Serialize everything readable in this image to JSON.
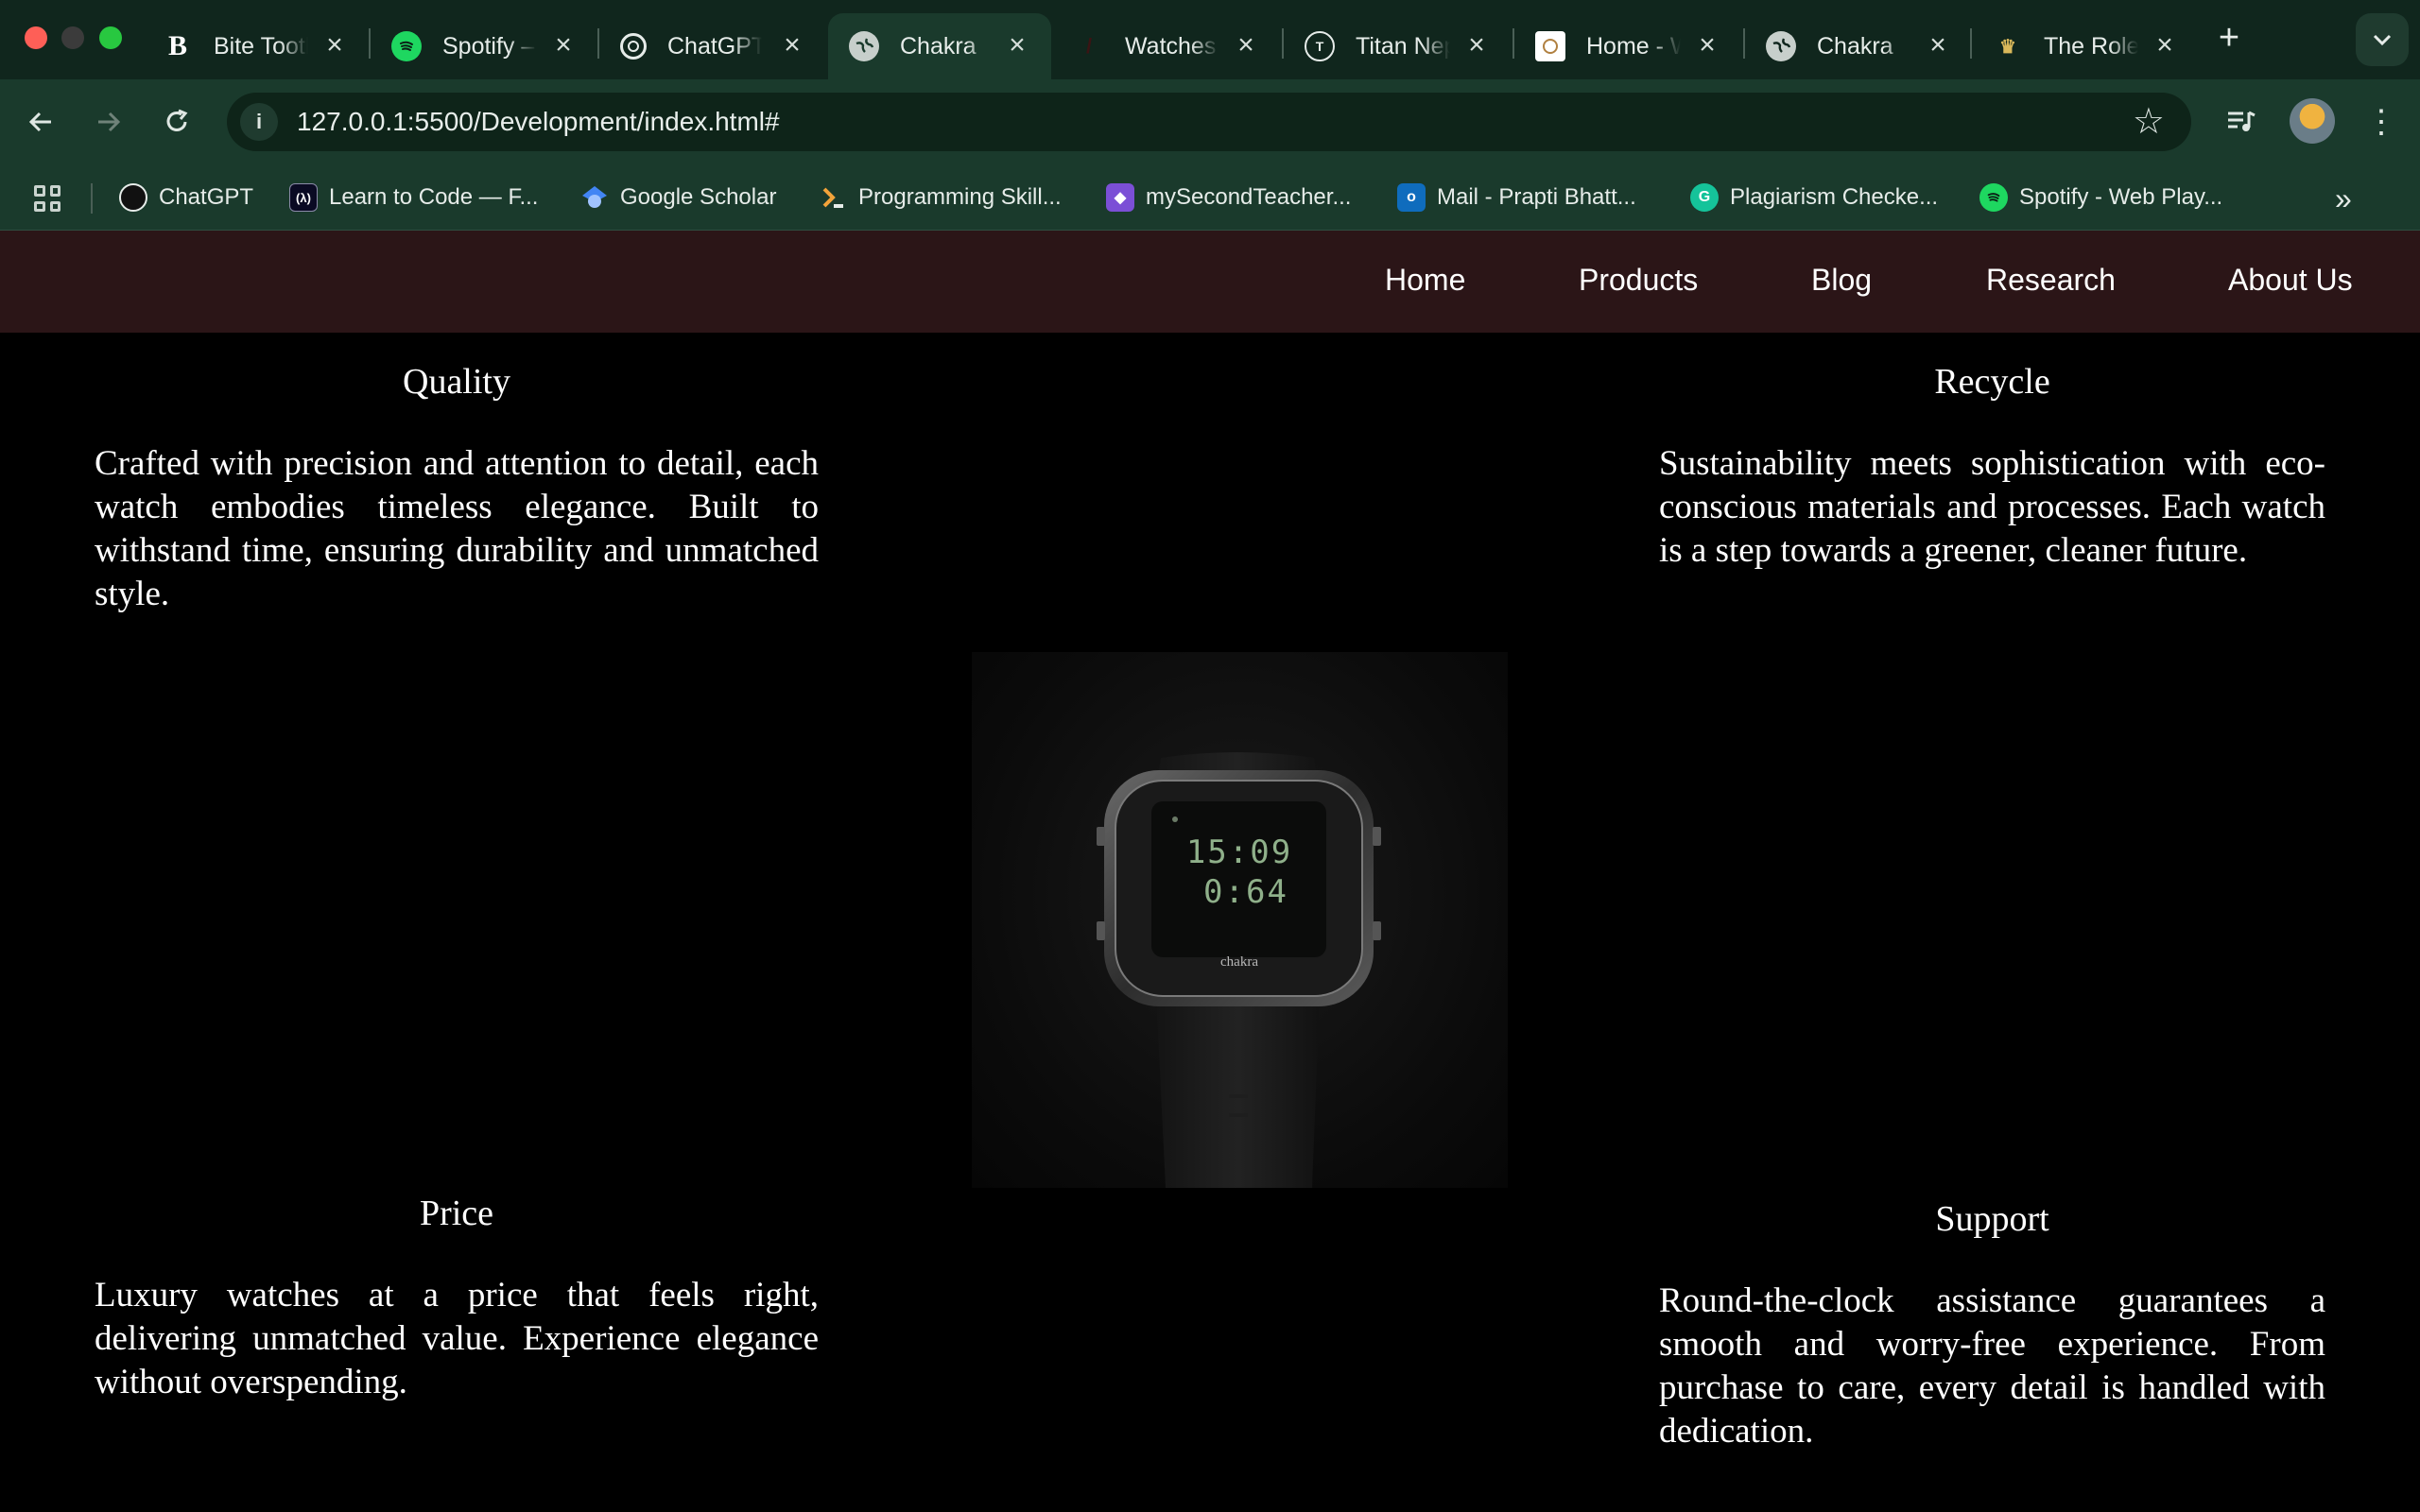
{
  "browser": {
    "tabs": [
      {
        "title": "Bite Tooth",
        "icon": "bold-b-icon"
      },
      {
        "title": "Spotify – Web",
        "icon": "spotify-icon"
      },
      {
        "title": "ChatGPT",
        "icon": "chatgpt-icon"
      },
      {
        "title": "Chakra",
        "icon": "globe-icon",
        "active": true
      },
      {
        "title": "Watches",
        "icon": "watches-icon"
      },
      {
        "title": "Titan Nepal",
        "icon": "titan-icon"
      },
      {
        "title": "Home - W",
        "icon": "home-site-icon"
      },
      {
        "title": "Chakra",
        "icon": "globe-icon"
      },
      {
        "title": "The Rolex",
        "icon": "rolex-crown-icon"
      }
    ],
    "url": "127.0.0.1:5500/Development/index.html#",
    "bookmarks": [
      {
        "label": "ChatGPT",
        "icon": "chatgpt-icon",
        "color": "#111111"
      },
      {
        "label": "Learn to Code — F...",
        "icon": "freecodecamp-icon",
        "color": "#0a0a23"
      },
      {
        "label": "Google Scholar",
        "icon": "scholar-icon",
        "color": "#4285f4"
      },
      {
        "label": "Programming Skill...",
        "icon": "programming-icon",
        "color": "#f2a33a"
      },
      {
        "label": "mySecondTeacher...",
        "icon": "mysecondteacher-icon",
        "color": "#7b4fd6"
      },
      {
        "label": "Mail - Prapti Bhatt...",
        "icon": "outlook-icon",
        "color": "#0f6cbd"
      },
      {
        "label": "Plagiarism Checke...",
        "icon": "grammarly-icon",
        "color": "#15c39a"
      },
      {
        "label": "Spotify - Web Play...",
        "icon": "spotify-icon",
        "color": "#1ed760"
      }
    ]
  },
  "site": {
    "nav": [
      "Home",
      "Products",
      "Blog",
      "Research",
      "About Us"
    ],
    "features": {
      "quality": {
        "title": "Quality",
        "text": "Crafted with precision and attention to detail, each watch embodies timeless elegance. Built to withstand time, ensuring durability and unmatched style."
      },
      "recycle": {
        "title": "Recycle",
        "text": "Sustainability meets sophistication with eco-conscious materials and processes. Each watch is a step towards a greener, cleaner future."
      },
      "price": {
        "title": "Price",
        "text": "Luxury watches at a price that feels right, delivering unmatched value. Experience elegance without overspending."
      },
      "support": {
        "title": "Support",
        "text": "Round-the-clock assistance guarantees a smooth and worry-free experience. From purchase to care, every detail is handled with dedication."
      }
    },
    "watch": {
      "time": "15:09",
      "secondary": "0:64",
      "brand": "chakra"
    },
    "colors": {
      "navbar": "#2b1517",
      "background": "#000000",
      "accent_lcd": "#8fb08a"
    }
  }
}
